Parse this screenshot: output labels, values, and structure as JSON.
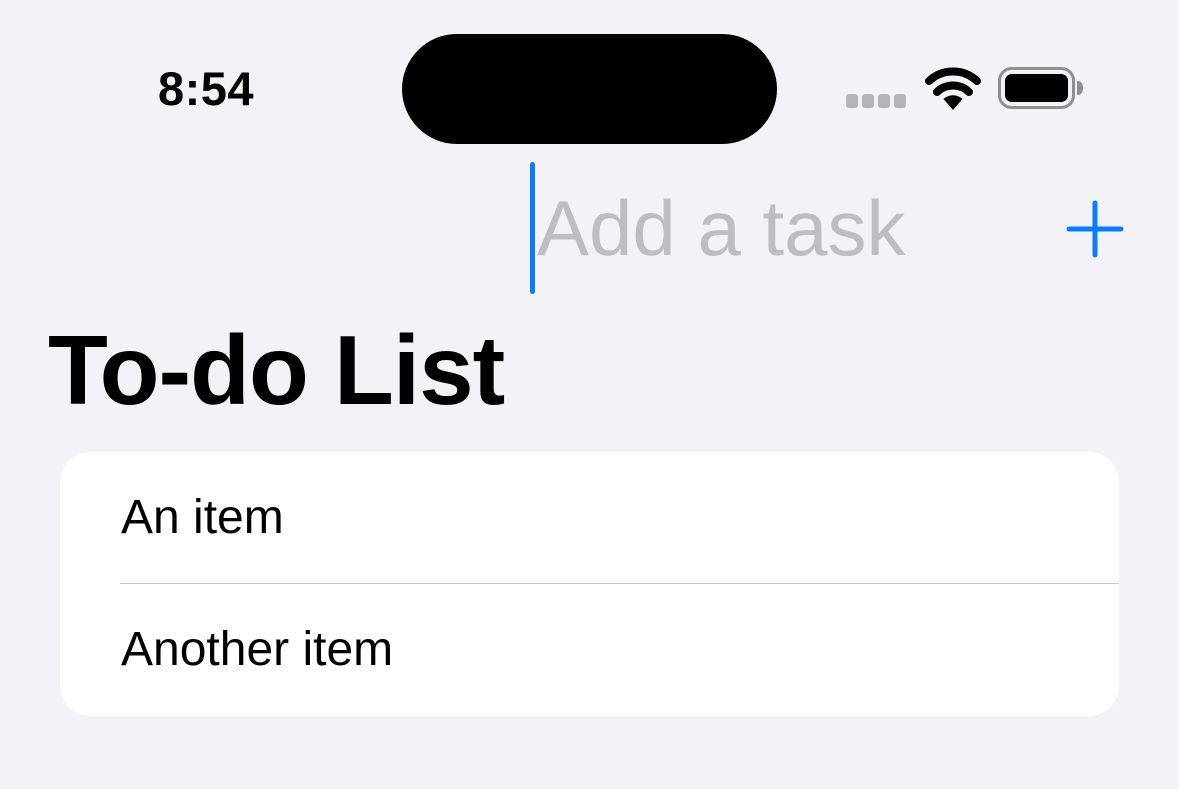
{
  "status_bar": {
    "time": "8:54",
    "icons": {
      "signal": "cellular-signal-icon",
      "wifi": "wifi-icon",
      "battery": "battery-icon"
    }
  },
  "nav": {
    "task_input": {
      "value": "",
      "placeholder": "Add a task"
    },
    "add_button_icon": "plus-icon"
  },
  "page": {
    "title": "To-do List"
  },
  "list": {
    "items": [
      {
        "label": "An item"
      },
      {
        "label": "Another item"
      }
    ]
  },
  "colors": {
    "background": "#F2F2F7",
    "accent": "#0A7CFF",
    "card": "#FFFFFF",
    "placeholder": "#BDBDC3",
    "separator": "#C6C6C8"
  }
}
